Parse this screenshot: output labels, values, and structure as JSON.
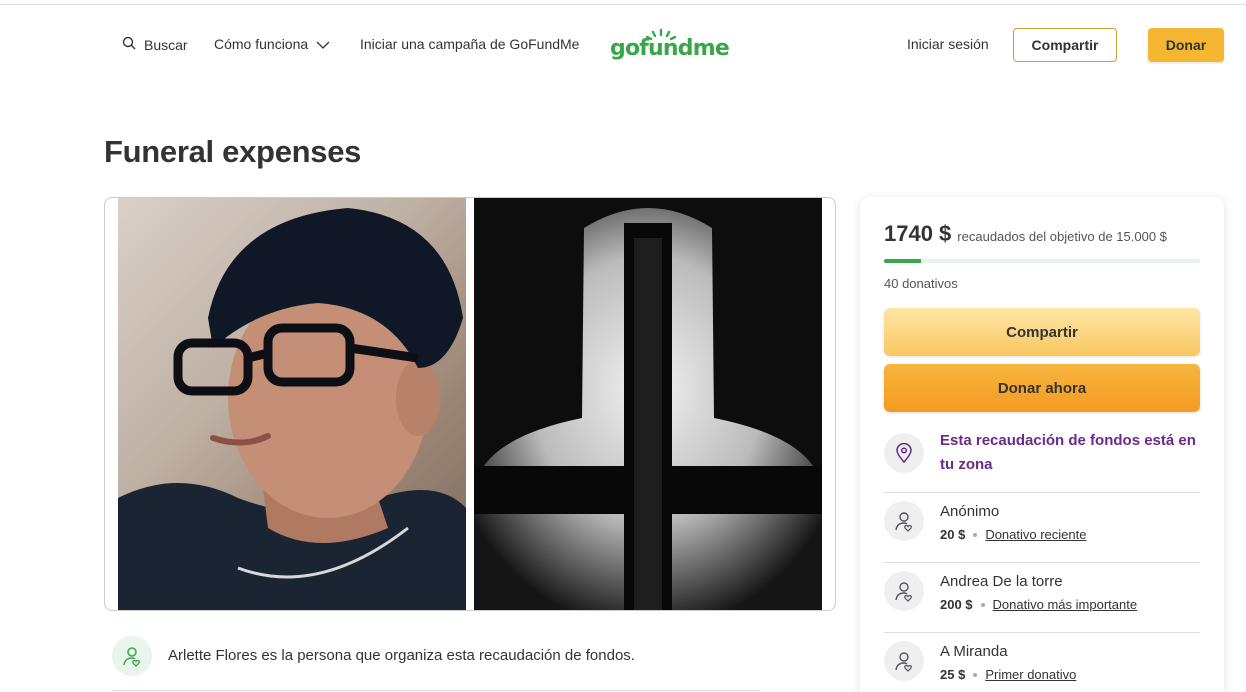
{
  "header": {
    "search_label": "Buscar",
    "how_label": "Cómo funciona",
    "start_label": "Iniciar una campaña de GoFundMe",
    "logo_text": "gofundme",
    "login_label": "Iniciar sesión",
    "share_label": "Compartir",
    "donate_label": "Donar"
  },
  "campaign": {
    "title": "Funeral expenses",
    "organizer_text": "Arlette Flores es la persona que organiza esta recaudación de fondos."
  },
  "sidebar": {
    "raised_amount": "1740 $",
    "raised_goal_text": "recaudados del objetivo de 15.000 $",
    "progress_fraction": 0.116,
    "donations_count": "40 donativos",
    "share_button": "Compartir",
    "donate_button": "Donar ahora",
    "local_notice": "Esta recaudación de fondos está en tu zona",
    "donors": [
      {
        "name": "Anónimo",
        "amount": "20 $",
        "tag": "Donativo reciente"
      },
      {
        "name": "Andrea De la torre",
        "amount": "200 $",
        "tag": "Donativo más importante"
      },
      {
        "name": "A Miranda",
        "amount": "25 $",
        "tag": "Primer donativo"
      }
    ]
  },
  "colors": {
    "brand_green": "#3aa64b",
    "donate_orange": "#f39b22",
    "local_purple": "#6b2a8a"
  },
  "icons": [
    "search-icon",
    "chevron-down-icon",
    "location-pin-icon",
    "donor-heart-icon",
    "organizer-heart-icon"
  ]
}
